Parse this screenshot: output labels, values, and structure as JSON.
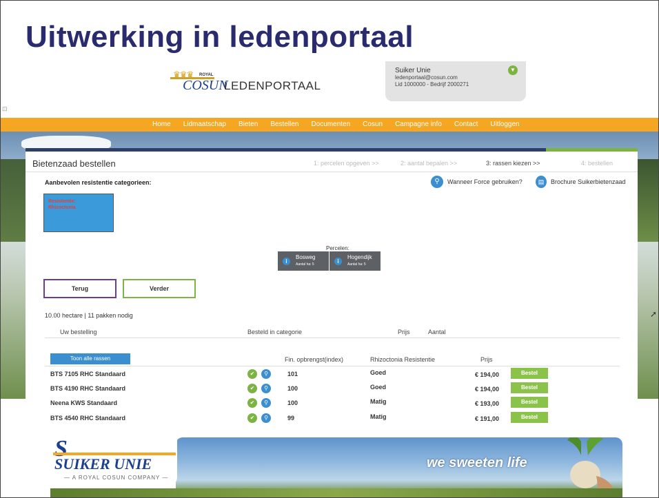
{
  "slide": {
    "title": "Uitwerking in ledenportaal"
  },
  "portal": {
    "logo_brand": "COSUN",
    "logo_royal": "ROYAL",
    "logo_portal": "LEDENPORTAAL"
  },
  "user": {
    "name": "Suiker Unie",
    "email": "ledenportaal@cosun.com",
    "lid": "Lid 1000000 - Bedrijf 2000271"
  },
  "nav": {
    "items": [
      "Home",
      "Lidmaatschap",
      "Bieten",
      "Bestellen",
      "Documenten",
      "Cosun",
      "Campagne info",
      "Contact",
      "Uitloggen"
    ]
  },
  "page": {
    "title": "Bietenzaad bestellen",
    "steps": [
      {
        "label": "1: percelen opgeven  >>"
      },
      {
        "label": "2: aantal bepalen  >>"
      },
      {
        "label": "3: rassen kiezen  >>"
      },
      {
        "label": "4: bestellen"
      }
    ],
    "recommended_title": "Aanbevolen resistentie categorieen:",
    "force_link": "Wanneer Force gebruiken?",
    "brochure_link": "Brochure Suikerbietenzaad",
    "category": {
      "line1": "Resistentie:",
      "line2": "Rhizoctonia"
    },
    "percelen_label": "Percelen:",
    "percelen": [
      {
        "name": "Bosweg",
        "sub": "Aantal ha: 5"
      },
      {
        "name": "Hogendijk",
        "sub": "Aantal ha: 5"
      }
    ],
    "back_button": "Terug",
    "next_button": "Verder",
    "hectare_info": "10.00 hectare  |  11 pakken nodig",
    "order_headers": {
      "col1": "Uw bestelling",
      "col2": "Besteld in categorie",
      "col3": "Prijs",
      "col4": "Aantal"
    },
    "show_all": "Toon alle rassen",
    "list_headers": {
      "yield": "Fin. opbrengst(index)",
      "resistance": "Rhizoctonia Resistentie",
      "price": "Prijs"
    },
    "varieties": [
      {
        "name": "BTS 7105 RHC Standaard",
        "index": "101",
        "resistance": "Goed",
        "price": "€ 194,00",
        "button": "Bestel"
      },
      {
        "name": "BTS 4190 RHC Standaard",
        "index": "100",
        "resistance": "Goed",
        "price": "€ 194,00",
        "button": "Bestel"
      },
      {
        "name": "Neena KWS Standaard",
        "index": "100",
        "resistance": "Matig",
        "price": "€ 193,00",
        "button": "Bestel"
      },
      {
        "name": "BTS 4540 RHC Standaard",
        "index": "99",
        "resistance": "Matig",
        "price": "€ 191,00",
        "button": "Bestel"
      }
    ]
  },
  "footer": {
    "brand": "SUIKER UNIE",
    "sub": "— A ROYAL COSUN COMPANY —",
    "slogan": "we sweeten life"
  },
  "icons": {
    "search": "search-icon",
    "thumb": "thumbs-up-icon",
    "info": "info-icon",
    "document": "document-icon",
    "toggle": "chevron-down-icon"
  }
}
